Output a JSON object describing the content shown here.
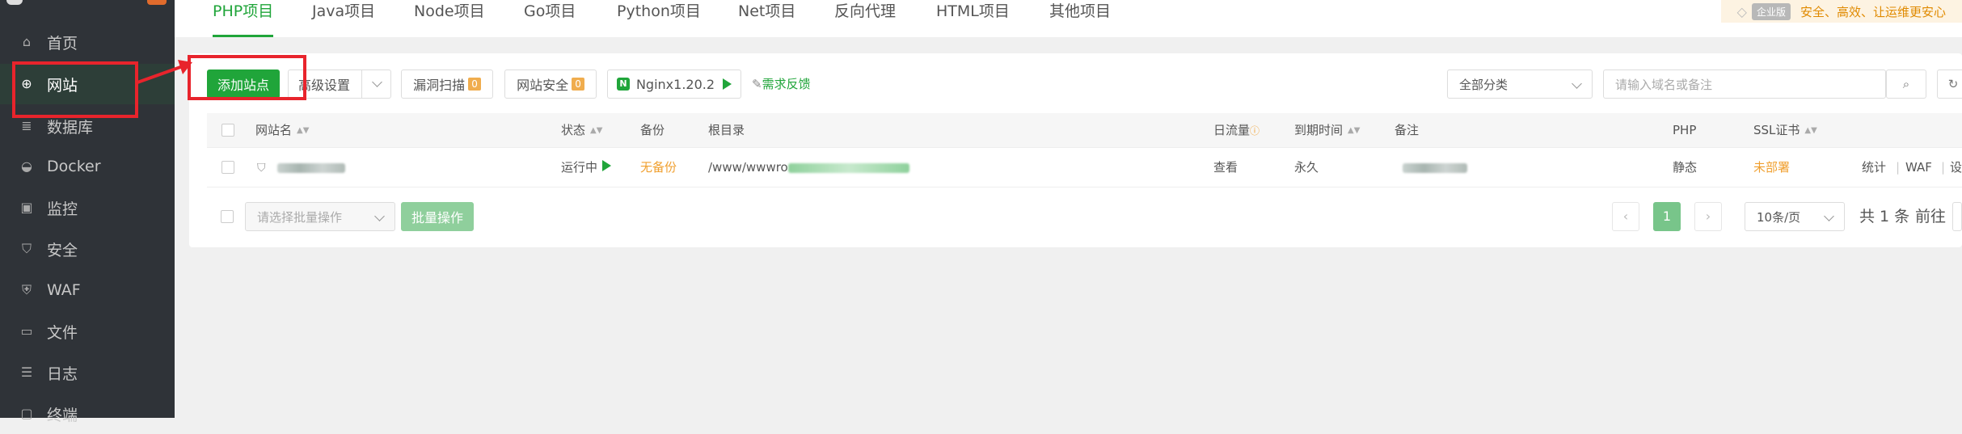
{
  "sidebar": {
    "items": [
      {
        "label": "首页",
        "icon": "home-icon"
      },
      {
        "label": "网站",
        "icon": "globe-icon"
      },
      {
        "label": "数据库",
        "icon": "database-icon"
      },
      {
        "label": "Docker",
        "icon": "docker-icon"
      },
      {
        "label": "监控",
        "icon": "monitor-icon"
      },
      {
        "label": "安全",
        "icon": "shield-icon"
      },
      {
        "label": "WAF",
        "icon": "waf-icon"
      },
      {
        "label": "文件",
        "icon": "folder-icon"
      },
      {
        "label": "日志",
        "icon": "log-icon"
      },
      {
        "label": "终端",
        "icon": "terminal-icon"
      }
    ]
  },
  "tabs": [
    "PHP项目",
    "Java项目",
    "Node项目",
    "Go项目",
    "Python项目",
    "Net项目",
    "反向代理",
    "HTML项目",
    "其他项目"
  ],
  "promo": {
    "badge": "企业版",
    "text": "安全、高效、让运维更安心"
  },
  "toolbar": {
    "add_site": "添加站点",
    "advanced": "高级设置",
    "vuln_scan": "漏洞扫描",
    "vuln_count": "0",
    "site_security": "网站安全",
    "security_count": "0",
    "nginx": "Nginx1.20.2",
    "feedback": "需求反馈",
    "category": "全部分类",
    "search_placeholder": "请输入域名或备注"
  },
  "table": {
    "headers": {
      "name": "网站名",
      "status": "状态",
      "backup": "备份",
      "root": "根目录",
      "traffic": "日流量",
      "expire": "到期时间",
      "remark": "备注",
      "php": "PHP",
      "ssl": "SSL证书"
    },
    "row": {
      "status": "运行中",
      "backup": "无备份",
      "root_prefix": "/www/wwwro",
      "traffic": "查看",
      "expire": "永久",
      "php": "静态",
      "ssl": "未部署",
      "actions": [
        "统计",
        "WAF",
        "设"
      ]
    }
  },
  "footer": {
    "batch_placeholder": "请选择批量操作",
    "batch_button": "批量操作",
    "current_page": "1",
    "page_size": "10条/页",
    "total": "共 1 条",
    "goto": "前往"
  },
  "colors": {
    "accent": "#20a53a",
    "sidebar": "#2f3338",
    "highlight": "#e8242c",
    "warning": "#f0ad4e"
  }
}
